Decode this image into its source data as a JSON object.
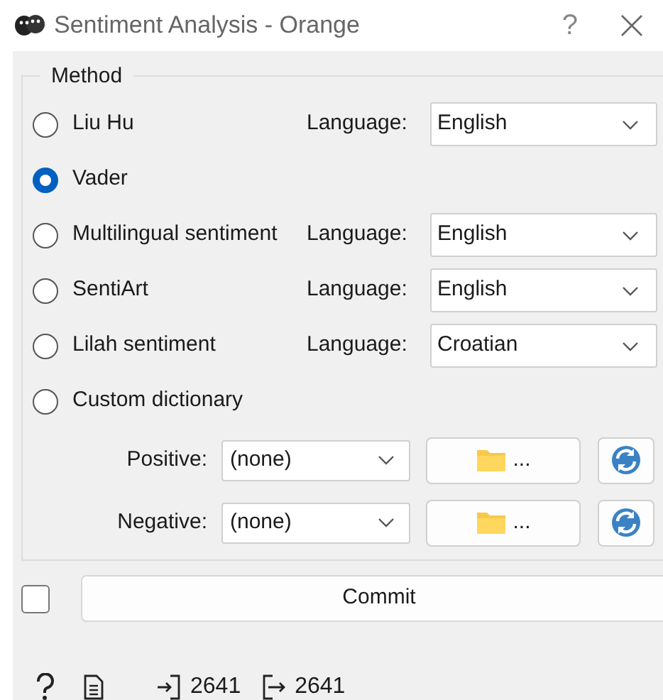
{
  "window": {
    "title": "Sentiment Analysis - Orange",
    "help": "?"
  },
  "method": {
    "title": "Method",
    "options": [
      {
        "label": "Liu Hu",
        "selected": false,
        "kind": "language",
        "language_label": "Language:",
        "language": "English"
      },
      {
        "label": "Vader",
        "selected": true,
        "kind": "plain"
      },
      {
        "label": "Multilingual sentiment",
        "selected": false,
        "kind": "language",
        "language_label": "Language:",
        "language": "English"
      },
      {
        "label": "SentiArt",
        "selected": false,
        "kind": "language",
        "language_label": "Language:",
        "language": "English"
      },
      {
        "label": "Lilah sentiment",
        "selected": false,
        "kind": "language",
        "language_label": "Language:",
        "language": "Croatian"
      },
      {
        "label": "Custom dictionary",
        "selected": false,
        "kind": "plain"
      }
    ],
    "dictionaries": [
      {
        "label": "Positive:",
        "value": "(none)",
        "browse": "..."
      },
      {
        "label": "Negative:",
        "value": "(none)",
        "browse": "..."
      }
    ]
  },
  "commit": {
    "auto_commit": false,
    "label": "Commit"
  },
  "status_bar": {
    "input_count": "2641",
    "output_count": "2641"
  }
}
